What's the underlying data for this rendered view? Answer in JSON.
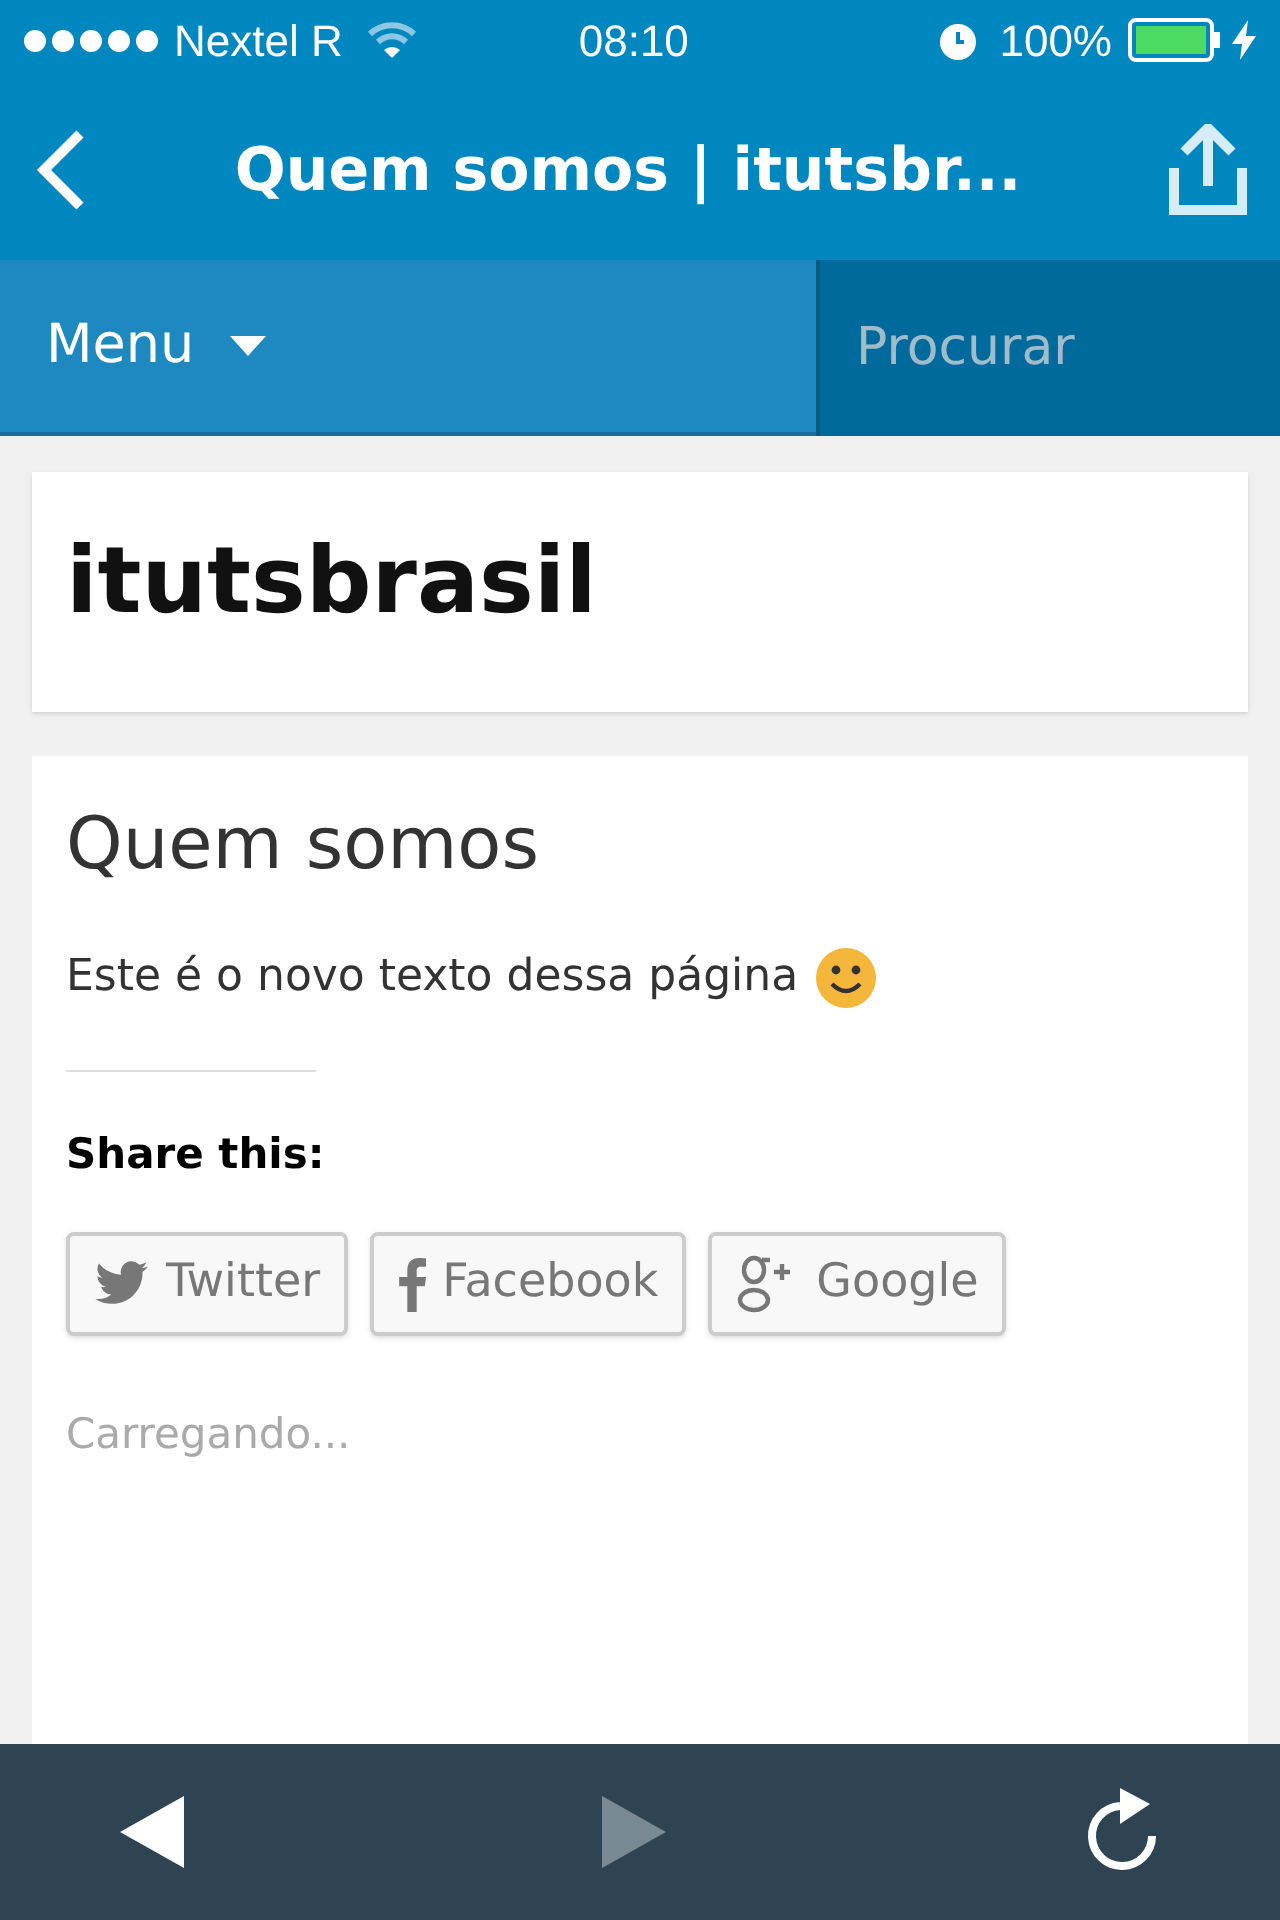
{
  "status_bar": {
    "carrier": "Nextel R",
    "time": "08:10",
    "battery": "100%"
  },
  "nav_bar": {
    "title": "Quem somos | itutsbr..."
  },
  "menu_bar": {
    "menu_label": "Menu",
    "search": {
      "placeholder": "Procurar"
    }
  },
  "site": {
    "title": "itutsbrasil"
  },
  "post": {
    "title": "Quem somos",
    "body": "Este é o novo texto dessa página",
    "share_heading": "Share this:",
    "share_buttons": [
      {
        "kind": "twitter",
        "label": "Twitter"
      },
      {
        "kind": "facebook",
        "label": "Facebook"
      },
      {
        "kind": "google",
        "label": "Google"
      }
    ],
    "loading": "Carregando..."
  },
  "toolbar": {
    "buttons": [
      {
        "kind": "back",
        "disabled": false
      },
      {
        "kind": "forward",
        "disabled": true
      },
      {
        "kind": "reload",
        "disabled": false
      }
    ]
  }
}
